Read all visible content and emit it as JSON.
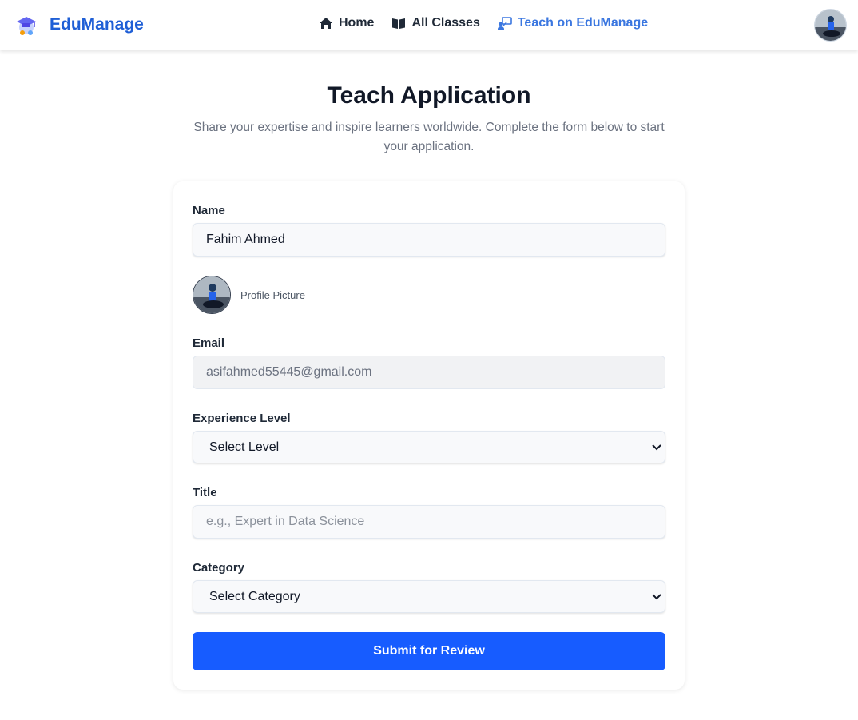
{
  "nav": {
    "brand_name": "EduManage",
    "links": [
      {
        "label": "Home",
        "icon": "home-icon"
      },
      {
        "label": "All Classes",
        "icon": "book-open-icon"
      },
      {
        "label": "Teach on EduManage",
        "icon": "teacher-icon",
        "active": true
      }
    ]
  },
  "header": {
    "title": "Teach Application",
    "subtitle": "Share your expertise and inspire learners worldwide. Complete the form below to start your application."
  },
  "form": {
    "name_label": "Name",
    "name_value": "Fahim Ahmed",
    "profile_caption": "Profile Picture",
    "email_label": "Email",
    "email_value": "asifahmed55445@gmail.com",
    "experience_label": "Experience Level",
    "experience_selected": "Select Level",
    "title_label": "Title",
    "title_placeholder": "e.g., Expert in Data Science",
    "category_label": "Category",
    "category_selected": "Select Category",
    "submit_label": "Submit for Review"
  },
  "colors": {
    "brand": "#1f5fd6",
    "active_link": "#3b77e0",
    "button": "#175cff"
  }
}
